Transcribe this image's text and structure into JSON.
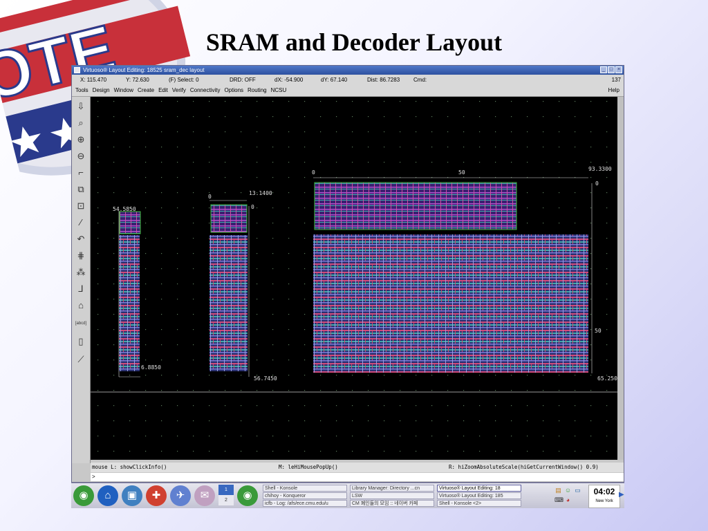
{
  "slide": {
    "title": "SRAM and Decoder Layout"
  },
  "logo": {
    "text": "VOTE",
    "red": "#c8303a",
    "blue": "#2a3a8c"
  },
  "window": {
    "title": "Virtuoso® Layout Editing: 18525 sram_dec layout",
    "controls": [
      "_",
      "□",
      "×"
    ],
    "status": {
      "x": "X: 115.470",
      "y": "Y: 72.630",
      "select": "(F) Select: 0",
      "drd": "DRD: OFF",
      "dx": "dX: -54.900",
      "dy": "dY: 67.140",
      "dist": "Dist: 86.7283",
      "cmd": "Cmd:",
      "count": "137"
    },
    "menu": [
      "Tools",
      "Design",
      "Window",
      "Create",
      "Edit",
      "Verify",
      "Connectivity",
      "Options",
      "Routing",
      "NCSU"
    ],
    "help": "Help",
    "toolbar_icons": [
      "save-icon",
      "zoom-fit-icon",
      "zoom-in-icon",
      "zoom-out-icon",
      "stretch-icon",
      "copy-icon",
      "move-icon",
      "delete-icon",
      "undo-icon",
      "properties-icon",
      "instance-icon",
      "path-icon",
      "polygon-icon",
      "label-icon",
      "rectangle-icon",
      "ruler-icon"
    ],
    "toolbar_label": "[abcd]",
    "rulers": {
      "r1_a": "54.5850",
      "r1_b": "6.8850",
      "r2_a": "0",
      "r2_b": "13.1400",
      "r2_c": "0",
      "r2_d": "56.7450",
      "r3_a": "0",
      "r3_b": "50",
      "r3_c": "93.3300",
      "r3_d": "0",
      "r3_e": "50",
      "r3_f": "65.2500"
    },
    "mouse": {
      "left": "mouse L: showClickInfo()",
      "middle": "M: leHiMousePopUp()",
      "right": "R: hiZoomAbsoluteScale(hiGetCurrentWindow() 0.9)"
    },
    "prompt": ">"
  },
  "taskbar": {
    "pager": [
      "1",
      "2"
    ],
    "tasks": [
      {
        "label": "Shell - Konsole"
      },
      {
        "label": "chihoy - Konqueror"
      },
      {
        "label": "icfb - Log: /afs/ece.cmu.edu/u"
      },
      {
        "label": "Library Manager: Directory ...cn"
      },
      {
        "label": "LSW"
      },
      {
        "label": "CM 폐인들의 모임 :: 네이버 카페"
      },
      {
        "label": "Virtuoso® Layout Editing: 18"
      },
      {
        "label": "Virtuoso® Layout Editing: 185"
      },
      {
        "label": "Shell - Konsole <2>"
      }
    ],
    "clock": {
      "time": "04:02",
      "city": "New York"
    }
  }
}
